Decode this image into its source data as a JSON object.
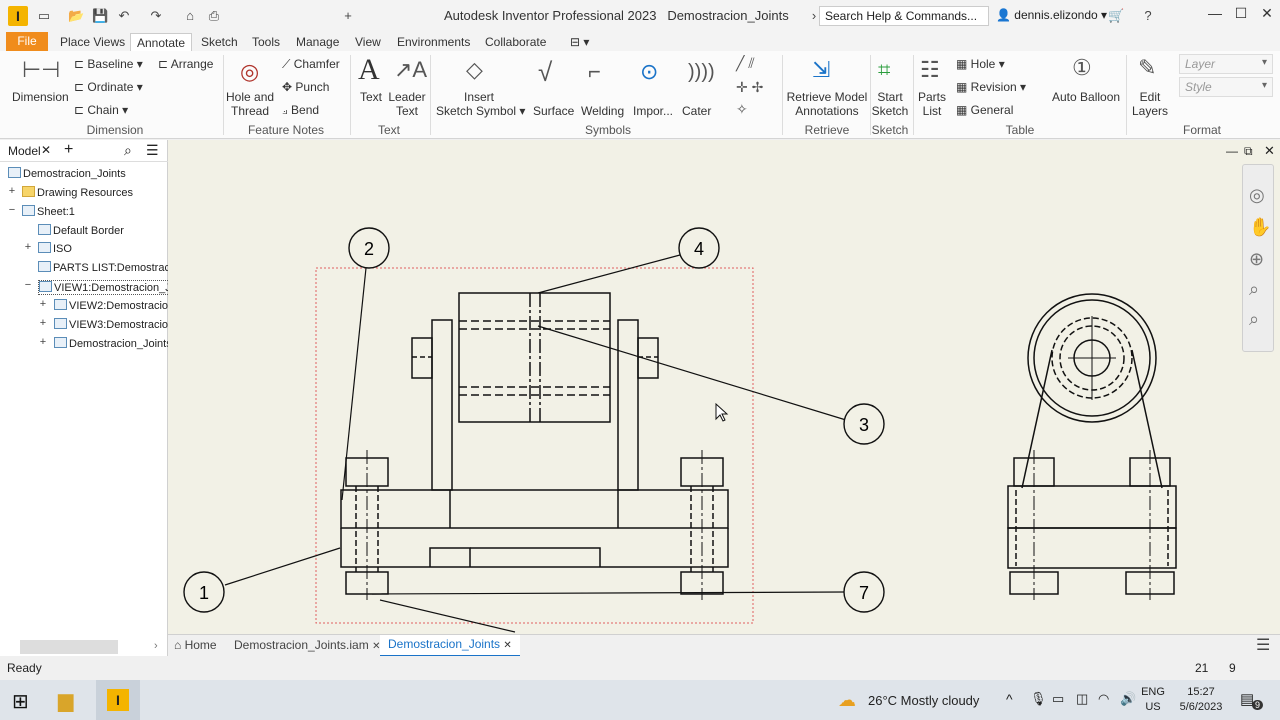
{
  "titlebar": {
    "app_title": "Autodesk Inventor Professional 2023",
    "doc_title": "Demostracion_Joints",
    "search_placeholder": "Search Help & Commands...",
    "user": "dennis.elizondo",
    "logo": "I"
  },
  "menu": {
    "tabs": [
      "File",
      "Place Views",
      "Annotate",
      "Sketch",
      "Tools",
      "Manage",
      "View",
      "Environments",
      "Collaborate"
    ],
    "active": "Annotate"
  },
  "ribbon": {
    "dimension": {
      "dimension": "Dimension",
      "baseline": "Baseline",
      "ordinate": "Ordinate",
      "chain": "Chain",
      "arrange": "Arrange",
      "title": "Dimension"
    },
    "feature_notes": {
      "hole_thread_1": "Hole and",
      "hole_thread_2": "Thread",
      "chamfer": "Chamfer",
      "punch": "Punch",
      "bend": "Bend",
      "title": "Feature Notes"
    },
    "text": {
      "text": "Text",
      "leader_1": "Leader",
      "leader_2": "Text",
      "title": "Text"
    },
    "insert_sketch_1": "Insert",
    "insert_sketch_2": "Sketch Symbol",
    "symbols": {
      "surface": "Surface",
      "welding": "Welding",
      "import": "Impor...",
      "caterpillar": "Cater",
      "title": "Symbols"
    },
    "retrieve": {
      "l1": "Retrieve Model",
      "l2": "Annotations",
      "title": "Retrieve"
    },
    "sketch": {
      "l1": "Start",
      "l2": "Sketch",
      "title": "Sketch"
    },
    "table": {
      "parts_1": "Parts",
      "parts_2": "List",
      "hole": "Hole",
      "revision": "Revision",
      "general": "General",
      "title": "Table"
    },
    "auto_balloon": "Auto Balloon",
    "format": {
      "edit_1": "Edit",
      "edit_2": "Layers",
      "layer": "Layer",
      "style": "Style",
      "title": "Format"
    }
  },
  "browser": {
    "tab": "Model",
    "items": [
      {
        "label": "Demostracion_Joints"
      },
      {
        "label": "Drawing Resources"
      },
      {
        "label": "Sheet:1"
      },
      {
        "label": "Default Border"
      },
      {
        "label": "ISO"
      },
      {
        "label": "PARTS LIST:Demostracio"
      },
      {
        "label": "VIEW1:Demostracion_Joi"
      },
      {
        "label": "VIEW2:Demostracion_"
      },
      {
        "label": "VIEW3:Demostracion_"
      },
      {
        "label": "Demostracion_Joints."
      }
    ]
  },
  "balloons": [
    "1",
    "2",
    "3",
    "4",
    "7"
  ],
  "doctabs": {
    "home": "Home",
    "iam": "Demostracion_Joints.iam",
    "active": "Demostracion_Joints"
  },
  "status": {
    "text": "Ready",
    "n1": "21",
    "n2": "9"
  },
  "taskbar": {
    "weather": "26°C  Mostly cloudy",
    "lang_1": "ENG",
    "lang_2": "US",
    "time": "15:27",
    "date": "5/6/2023",
    "notif": "9"
  },
  "colors": {
    "file_tab": "#f08c1c",
    "canvas": "#f2f1e6",
    "accent": "#1a73c8"
  }
}
